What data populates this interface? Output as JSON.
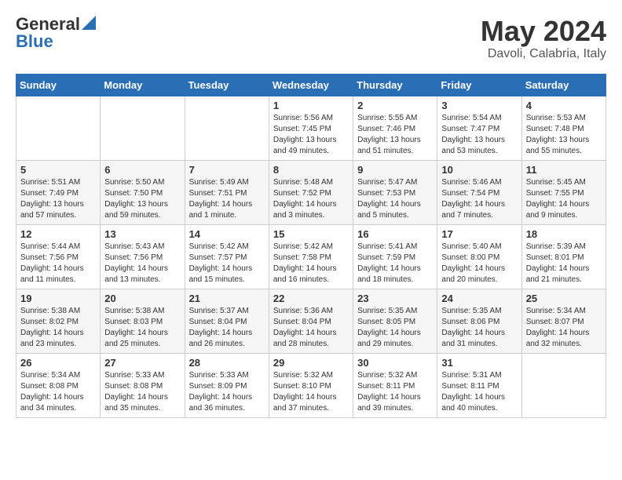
{
  "logo": {
    "general": "General",
    "blue": "Blue"
  },
  "calendar": {
    "title": "May 2024",
    "subtitle": "Davoli, Calabria, Italy"
  },
  "weekdays": [
    "Sunday",
    "Monday",
    "Tuesday",
    "Wednesday",
    "Thursday",
    "Friday",
    "Saturday"
  ],
  "weeks": [
    [
      {
        "day": "",
        "info": ""
      },
      {
        "day": "",
        "info": ""
      },
      {
        "day": "",
        "info": ""
      },
      {
        "day": "1",
        "info": "Sunrise: 5:56 AM\nSunset: 7:45 PM\nDaylight: 13 hours\nand 49 minutes."
      },
      {
        "day": "2",
        "info": "Sunrise: 5:55 AM\nSunset: 7:46 PM\nDaylight: 13 hours\nand 51 minutes."
      },
      {
        "day": "3",
        "info": "Sunrise: 5:54 AM\nSunset: 7:47 PM\nDaylight: 13 hours\nand 53 minutes."
      },
      {
        "day": "4",
        "info": "Sunrise: 5:53 AM\nSunset: 7:48 PM\nDaylight: 13 hours\nand 55 minutes."
      }
    ],
    [
      {
        "day": "5",
        "info": "Sunrise: 5:51 AM\nSunset: 7:49 PM\nDaylight: 13 hours\nand 57 minutes."
      },
      {
        "day": "6",
        "info": "Sunrise: 5:50 AM\nSunset: 7:50 PM\nDaylight: 13 hours\nand 59 minutes."
      },
      {
        "day": "7",
        "info": "Sunrise: 5:49 AM\nSunset: 7:51 PM\nDaylight: 14 hours\nand 1 minute."
      },
      {
        "day": "8",
        "info": "Sunrise: 5:48 AM\nSunset: 7:52 PM\nDaylight: 14 hours\nand 3 minutes."
      },
      {
        "day": "9",
        "info": "Sunrise: 5:47 AM\nSunset: 7:53 PM\nDaylight: 14 hours\nand 5 minutes."
      },
      {
        "day": "10",
        "info": "Sunrise: 5:46 AM\nSunset: 7:54 PM\nDaylight: 14 hours\nand 7 minutes."
      },
      {
        "day": "11",
        "info": "Sunrise: 5:45 AM\nSunset: 7:55 PM\nDaylight: 14 hours\nand 9 minutes."
      }
    ],
    [
      {
        "day": "12",
        "info": "Sunrise: 5:44 AM\nSunset: 7:56 PM\nDaylight: 14 hours\nand 11 minutes."
      },
      {
        "day": "13",
        "info": "Sunrise: 5:43 AM\nSunset: 7:56 PM\nDaylight: 14 hours\nand 13 minutes."
      },
      {
        "day": "14",
        "info": "Sunrise: 5:42 AM\nSunset: 7:57 PM\nDaylight: 14 hours\nand 15 minutes."
      },
      {
        "day": "15",
        "info": "Sunrise: 5:42 AM\nSunset: 7:58 PM\nDaylight: 14 hours\nand 16 minutes."
      },
      {
        "day": "16",
        "info": "Sunrise: 5:41 AM\nSunset: 7:59 PM\nDaylight: 14 hours\nand 18 minutes."
      },
      {
        "day": "17",
        "info": "Sunrise: 5:40 AM\nSunset: 8:00 PM\nDaylight: 14 hours\nand 20 minutes."
      },
      {
        "day": "18",
        "info": "Sunrise: 5:39 AM\nSunset: 8:01 PM\nDaylight: 14 hours\nand 21 minutes."
      }
    ],
    [
      {
        "day": "19",
        "info": "Sunrise: 5:38 AM\nSunset: 8:02 PM\nDaylight: 14 hours\nand 23 minutes."
      },
      {
        "day": "20",
        "info": "Sunrise: 5:38 AM\nSunset: 8:03 PM\nDaylight: 14 hours\nand 25 minutes."
      },
      {
        "day": "21",
        "info": "Sunrise: 5:37 AM\nSunset: 8:04 PM\nDaylight: 14 hours\nand 26 minutes."
      },
      {
        "day": "22",
        "info": "Sunrise: 5:36 AM\nSunset: 8:04 PM\nDaylight: 14 hours\nand 28 minutes."
      },
      {
        "day": "23",
        "info": "Sunrise: 5:35 AM\nSunset: 8:05 PM\nDaylight: 14 hours\nand 29 minutes."
      },
      {
        "day": "24",
        "info": "Sunrise: 5:35 AM\nSunset: 8:06 PM\nDaylight: 14 hours\nand 31 minutes."
      },
      {
        "day": "25",
        "info": "Sunrise: 5:34 AM\nSunset: 8:07 PM\nDaylight: 14 hours\nand 32 minutes."
      }
    ],
    [
      {
        "day": "26",
        "info": "Sunrise: 5:34 AM\nSunset: 8:08 PM\nDaylight: 14 hours\nand 34 minutes."
      },
      {
        "day": "27",
        "info": "Sunrise: 5:33 AM\nSunset: 8:08 PM\nDaylight: 14 hours\nand 35 minutes."
      },
      {
        "day": "28",
        "info": "Sunrise: 5:33 AM\nSunset: 8:09 PM\nDaylight: 14 hours\nand 36 minutes."
      },
      {
        "day": "29",
        "info": "Sunrise: 5:32 AM\nSunset: 8:10 PM\nDaylight: 14 hours\nand 37 minutes."
      },
      {
        "day": "30",
        "info": "Sunrise: 5:32 AM\nSunset: 8:11 PM\nDaylight: 14 hours\nand 39 minutes."
      },
      {
        "day": "31",
        "info": "Sunrise: 5:31 AM\nSunset: 8:11 PM\nDaylight: 14 hours\nand 40 minutes."
      },
      {
        "day": "",
        "info": ""
      }
    ]
  ]
}
